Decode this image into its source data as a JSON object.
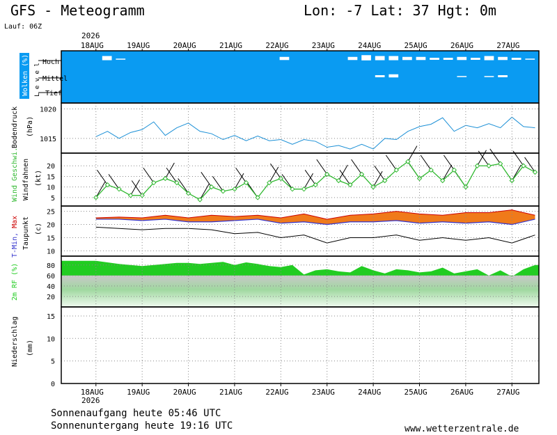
{
  "header": {
    "title": "GFS - Meteogramm",
    "location": "Lon: -7 Lat: 37 Hgt: 0m",
    "run": "Lauf: 06Z",
    "year": "2026"
  },
  "footer": {
    "sunrise": "Sonnenaufgang heute 05:46 UTC",
    "sunset": "Sonnenuntergang heute 19:16 UTC",
    "site": "www.wetterzentrale.de"
  },
  "colors": {
    "cloud_bg": "#0a9bf2",
    "pressure": "#1a8fd6",
    "wind": "#2fb82f",
    "tmin": "#3333cc",
    "tmax": "#cc0000",
    "temp_band": "#f07a1a",
    "rh": "#22cc22",
    "grid": "#888888"
  },
  "chart_data": [
    {
      "type": "area",
      "name_label": "Wolken (%)",
      "ylabel": "L e v e l",
      "levels": [
        "Hoch",
        "Mittel",
        "Tief"
      ],
      "x": [
        "18AUG",
        "19AUG",
        "20AUG",
        "21AUG",
        "22AUG",
        "23AUG",
        "24AUG",
        "25AUG",
        "26AUG",
        "27AUG"
      ],
      "cover_hoch": [
        100,
        100,
        100,
        60,
        90,
        100,
        100,
        100,
        100,
        100,
        100,
        100,
        100,
        100,
        100,
        100,
        70,
        100,
        100,
        100,
        100,
        70,
        50,
        60,
        60,
        70,
        70,
        80,
        80,
        70,
        80,
        60,
        70,
        80,
        90
      ],
      "cover_mittel": [
        100,
        100,
        100,
        100,
        100,
        100,
        100,
        100,
        100,
        100,
        100,
        100,
        100,
        100,
        100,
        100,
        100,
        100,
        100,
        100,
        100,
        100,
        100,
        80,
        70,
        100,
        100,
        100,
        100,
        90,
        100,
        90,
        80,
        100,
        100
      ],
      "cover_tief": [
        100,
        100,
        100,
        100,
        100,
        100,
        100,
        100,
        100,
        100,
        100,
        100,
        100,
        100,
        100,
        100,
        100,
        100,
        100,
        100,
        100,
        100,
        100,
        100,
        100,
        100,
        100,
        100,
        100,
        100,
        100,
        100,
        100,
        100,
        100
      ]
    },
    {
      "type": "line",
      "ylabel": "Bodendruck",
      "unit": "(hPa)",
      "yticks": [
        1015,
        1020
      ],
      "x_hours": [
        0,
        6,
        12,
        18,
        24,
        30,
        36,
        42,
        48,
        54,
        60,
        66,
        72,
        78,
        84,
        90,
        96,
        102,
        108,
        114,
        120,
        126,
        132,
        138,
        144,
        150,
        156,
        162,
        168,
        174,
        180,
        186,
        192,
        198,
        204,
        210,
        216,
        222,
        228
      ],
      "values": [
        1015.3,
        1016.2,
        1015.0,
        1016.0,
        1016.5,
        1017.8,
        1015.5,
        1016.8,
        1017.6,
        1016.2,
        1015.8,
        1014.8,
        1015.5,
        1014.6,
        1015.4,
        1014.6,
        1014.8,
        1014.0,
        1014.8,
        1014.5,
        1013.5,
        1013.8,
        1013.2,
        1014.0,
        1013.2,
        1015.0,
        1014.8,
        1016.2,
        1017.0,
        1017.4,
        1018.5,
        1016.2,
        1017.2,
        1016.8,
        1017.5,
        1016.8,
        1018.6,
        1017.0,
        1016.8
      ],
      "ylim": [
        1012.5,
        1021
      ]
    },
    {
      "type": "line",
      "ylabel": "Wind Geschwi.",
      "ylabel2": "Windfahnen",
      "unit": "(kt)",
      "yticks": [
        5,
        10,
        15,
        20
      ],
      "ylim": [
        1,
        26
      ],
      "x_hours": [
        0,
        6,
        12,
        18,
        24,
        30,
        36,
        42,
        48,
        54,
        60,
        66,
        72,
        78,
        84,
        90,
        96,
        102,
        108,
        114,
        120,
        126,
        132,
        138,
        144,
        150,
        156,
        162,
        168,
        174,
        180,
        186,
        192,
        198,
        204,
        210,
        216,
        222,
        228
      ],
      "values": [
        5,
        11,
        9,
        6,
        6,
        12,
        14,
        12,
        7,
        4,
        10,
        8,
        9,
        12,
        5,
        12,
        14,
        9,
        9,
        11,
        16,
        13,
        11,
        16,
        10,
        13,
        18,
        22,
        14,
        18,
        13,
        18,
        10,
        20,
        20,
        21,
        13,
        20,
        17
      ]
    },
    {
      "type": "line",
      "ylabel": "T-Min, Max",
      "ylabel2": "Taupunkt",
      "unit": "(c)",
      "yticks": [
        10,
        15,
        20,
        25
      ],
      "ylim": [
        8,
        27
      ],
      "x_hours": [
        0,
        12,
        24,
        36,
        48,
        60,
        72,
        84,
        96,
        108,
        120,
        132,
        144,
        156,
        168,
        180,
        192,
        204,
        216,
        228
      ],
      "tmin": [
        22,
        22,
        21.5,
        22,
        21,
        21,
        21.5,
        22,
        20.5,
        21,
        20,
        21,
        21,
        21.5,
        20.5,
        21,
        20.5,
        21,
        20,
        22
      ],
      "tmax": [
        22.5,
        22.8,
        22.5,
        23.5,
        22.5,
        23.5,
        23,
        23.5,
        22.5,
        24,
        22,
        23.5,
        24,
        25,
        24,
        23.5,
        24.5,
        24.5,
        25.5,
        23.5
      ],
      "dewpoint": [
        19,
        18.5,
        18,
        18.5,
        18.5,
        18,
        16.5,
        17,
        15,
        16,
        13,
        15,
        15,
        16,
        14,
        15,
        14,
        15,
        13,
        16
      ]
    },
    {
      "type": "area",
      "ylabel": "2m RF (%)",
      "yticks": [
        20,
        40,
        60,
        80
      ],
      "ylim": [
        0,
        97
      ],
      "x_hours": [
        0,
        6,
        12,
        18,
        24,
        30,
        36,
        42,
        48,
        54,
        60,
        66,
        72,
        78,
        84,
        90,
        96,
        102,
        108,
        114,
        120,
        126,
        132,
        138,
        144,
        150,
        156,
        162,
        168,
        174,
        180,
        186,
        192,
        198,
        204,
        210,
        216,
        222,
        228
      ],
      "values": [
        88,
        85,
        82,
        80,
        78,
        80,
        82,
        84,
        84,
        82,
        84,
        86,
        80,
        85,
        82,
        78,
        76,
        80,
        62,
        70,
        72,
        68,
        66,
        78,
        70,
        64,
        72,
        70,
        66,
        68,
        75,
        64,
        68,
        72,
        60,
        70,
        58,
        72,
        80
      ]
    },
    {
      "type": "bar",
      "ylabel": "Niederschlag",
      "unit": "(mm)",
      "yticks": [
        0,
        5,
        10,
        15
      ],
      "ylim": [
        0,
        17
      ],
      "x_hours": [],
      "values": []
    }
  ]
}
